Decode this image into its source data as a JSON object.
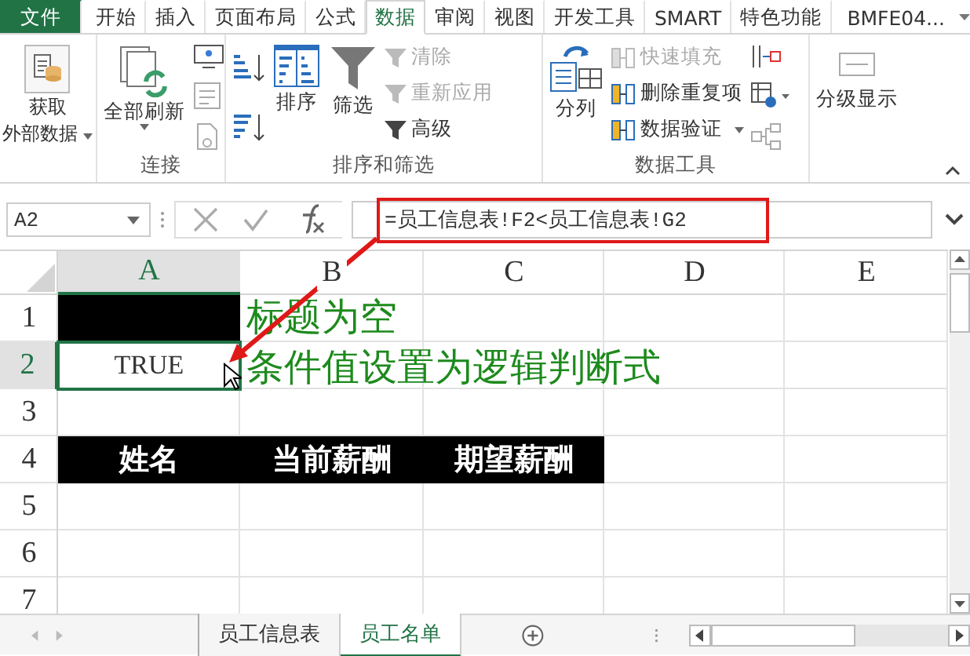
{
  "ribbon_tabs": [
    {
      "label": "文件",
      "kind": "file",
      "selected": false
    },
    {
      "label": "开始",
      "kind": "tab",
      "selected": false
    },
    {
      "label": "插入",
      "kind": "tab",
      "selected": false
    },
    {
      "label": "页面布局",
      "kind": "tab",
      "selected": false
    },
    {
      "label": "公式",
      "kind": "tab",
      "selected": false
    },
    {
      "label": "数据",
      "kind": "tab",
      "selected": true
    },
    {
      "label": "审阅",
      "kind": "tab",
      "selected": false
    },
    {
      "label": "视图",
      "kind": "tab",
      "selected": false
    },
    {
      "label": "开发工具",
      "kind": "tab",
      "selected": false
    },
    {
      "label": "SMART",
      "kind": "tab",
      "selected": false
    },
    {
      "label": "特色功能",
      "kind": "tab",
      "selected": false
    },
    {
      "label": "BMFE04...",
      "kind": "account",
      "selected": false
    }
  ],
  "ribbon": {
    "get_data": {
      "lines": [
        "获取",
        "外部数据"
      ]
    },
    "connections": {
      "refresh_all": "全部刷新",
      "label": "连接"
    },
    "sort_filter": {
      "sort": "排序",
      "filter": "筛选",
      "small": [
        {
          "label": "清除",
          "disabled": true
        },
        {
          "label": "重新应用",
          "disabled": true
        },
        {
          "label": "高级",
          "disabled": false
        }
      ],
      "label": "排序和筛选"
    },
    "data_tools": {
      "text_to_columns": "分列",
      "small": [
        {
          "label": "快速填充",
          "disabled": true
        },
        {
          "label": "删除重复项",
          "disabled": false
        },
        {
          "label": "数据验证",
          "disabled": false
        }
      ],
      "label": "数据工具"
    },
    "outline": {
      "label": "分级显示"
    }
  },
  "formula_bar": {
    "name_box": "A2",
    "formula": "=员工信息表!F2<员工信息表!G2"
  },
  "columns": [
    {
      "label": "A",
      "selected": true
    },
    {
      "label": "B",
      "selected": false
    },
    {
      "label": "C",
      "selected": false
    },
    {
      "label": "D",
      "selected": false
    },
    {
      "label": "E",
      "selected": false
    }
  ],
  "rows": [
    {
      "header": "1",
      "selected": false,
      "cells": [
        {
          "filled": true
        },
        {
          "filled": false
        },
        {
          "filled": false
        },
        {
          "filled": false
        },
        {
          "filled": false
        }
      ]
    },
    {
      "header": "2",
      "selected": true,
      "cells": [
        {
          "filled": false,
          "text": "TRUE",
          "selected": true
        },
        {
          "filled": false
        },
        {
          "filled": false
        },
        {
          "filled": false
        },
        {
          "filled": false
        }
      ]
    },
    {
      "header": "3",
      "selected": false,
      "cells": [
        {
          "filled": false
        },
        {
          "filled": false
        },
        {
          "filled": false
        },
        {
          "filled": false
        },
        {
          "filled": false
        }
      ]
    },
    {
      "header": "4",
      "selected": false,
      "cells": [
        {
          "filled": true,
          "text": "姓名"
        },
        {
          "filled": true,
          "text": "当前薪酬"
        },
        {
          "filled": true,
          "text": "期望薪酬"
        },
        {
          "filled": false
        },
        {
          "filled": false
        }
      ]
    },
    {
      "header": "5",
      "selected": false,
      "cells": [
        {
          "filled": false
        },
        {
          "filled": false
        },
        {
          "filled": false
        },
        {
          "filled": false
        },
        {
          "filled": false
        }
      ]
    },
    {
      "header": "6",
      "selected": false,
      "cells": [
        {
          "filled": false
        },
        {
          "filled": false
        },
        {
          "filled": false
        },
        {
          "filled": false
        },
        {
          "filled": false
        }
      ]
    },
    {
      "header": "7",
      "selected": false,
      "cells": [
        {
          "filled": false
        },
        {
          "filled": false
        },
        {
          "filled": false
        },
        {
          "filled": false
        },
        {
          "filled": false
        }
      ]
    }
  ],
  "annotations": [
    "标题为空",
    "条件值设置为逻辑判断式"
  ],
  "sheet_tabs": [
    {
      "label": "员工信息表",
      "selected": false
    },
    {
      "label": "员工名单",
      "selected": true
    }
  ]
}
